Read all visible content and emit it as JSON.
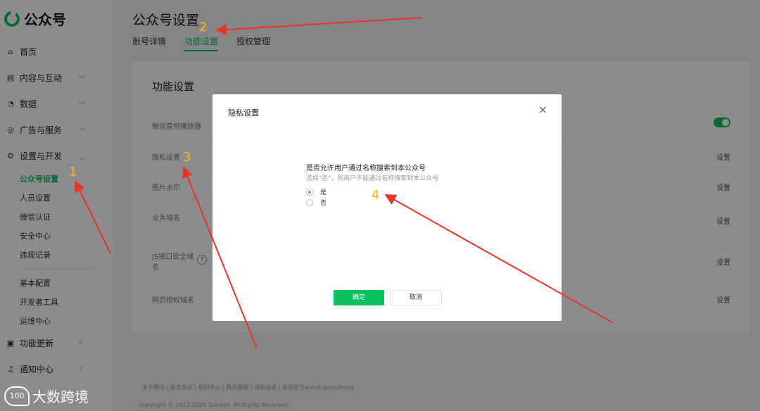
{
  "brand": {
    "name": "公众号"
  },
  "nav": {
    "home": "首页",
    "content": "内容与互动",
    "data": "数据",
    "ads": "广告与服务",
    "settings": "设置与开发",
    "sub": [
      "公众号设置",
      "人员设置",
      "微信认证",
      "安全中心",
      "违规记录"
    ],
    "sub2": [
      "基本配置",
      "开发者工具",
      "运维中心"
    ],
    "updates": "功能更新",
    "notify": "通知中心"
  },
  "page": {
    "title": "公众号设置",
    "tabs": [
      "账号详情",
      "功能设置",
      "授权管理"
    ],
    "active_tab": "功能设置"
  },
  "card": {
    "title": "功能设置",
    "rows": [
      {
        "label": "微信音频播放器",
        "action": ""
      },
      {
        "label": "隐私设置",
        "action": "设置"
      },
      {
        "label": "图片水印",
        "action": "设置"
      },
      {
        "label": "业务域名",
        "action": "设置"
      },
      {
        "label": "JS接口安全域名",
        "action": "设置"
      },
      {
        "label": "网页授权域名",
        "action": "设置"
      }
    ],
    "help_icon": "?"
  },
  "footer": {
    "links": "关于腾讯 | 服务协议 | 规则中心 | 腾讯客服 | 侵权投诉 | 反馈官号weixingongzhong",
    "copyright": "Copyright © 2012-2024 Tencent. All Rights Reserved."
  },
  "modal": {
    "title": "隐私设置",
    "close": "×",
    "question": "是否允许用户通过名称搜索到本公众号",
    "hint": "选择\"否\"，则用户不能通过名称搜索到本公众号",
    "options": [
      "是",
      "否"
    ],
    "selected": "是",
    "ok": "确定",
    "cancel": "取消"
  },
  "annotations": {
    "n1": "1",
    "n2": "2",
    "n3": "3",
    "n4": "4",
    "arrow_color": "#e8342a",
    "number_color": "#f2b81a"
  },
  "watermark": {
    "text": "大数跨境",
    "logo": "100"
  },
  "colors": {
    "accent": "#07c160"
  }
}
